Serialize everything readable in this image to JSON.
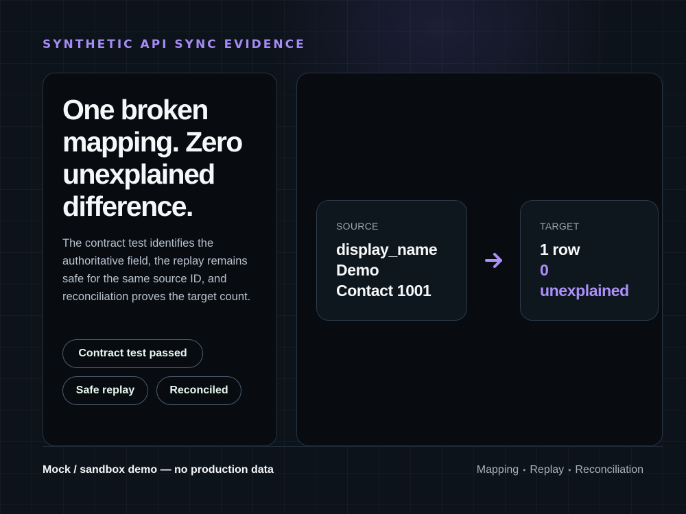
{
  "header": {
    "eyebrow": "SYNTHETIC API SYNC EVIDENCE"
  },
  "summary": {
    "headline": "One broken mapping. Zero unexplained difference.",
    "description": "The contract test identifies the authoritative field, the replay remains safe for the same source ID, and reconciliation proves the target count.",
    "badges": [
      "Contract test passed",
      "Safe replay",
      "Reconciled"
    ]
  },
  "flow": {
    "source": {
      "label": "SOURCE",
      "lines": [
        "display_name",
        "Demo",
        "Contact 1001"
      ]
    },
    "arrow_icon": "arrow-right-icon",
    "target": {
      "label": "TARGET",
      "lines": [
        "1 row",
        "0",
        "unexplained"
      ]
    },
    "colors": {
      "accent": "#ab90fa"
    }
  },
  "footer": {
    "note": "Mock / sandbox demo — no production data",
    "steps": [
      "Mapping",
      "Replay",
      "Reconciliation"
    ],
    "separator": "•"
  }
}
